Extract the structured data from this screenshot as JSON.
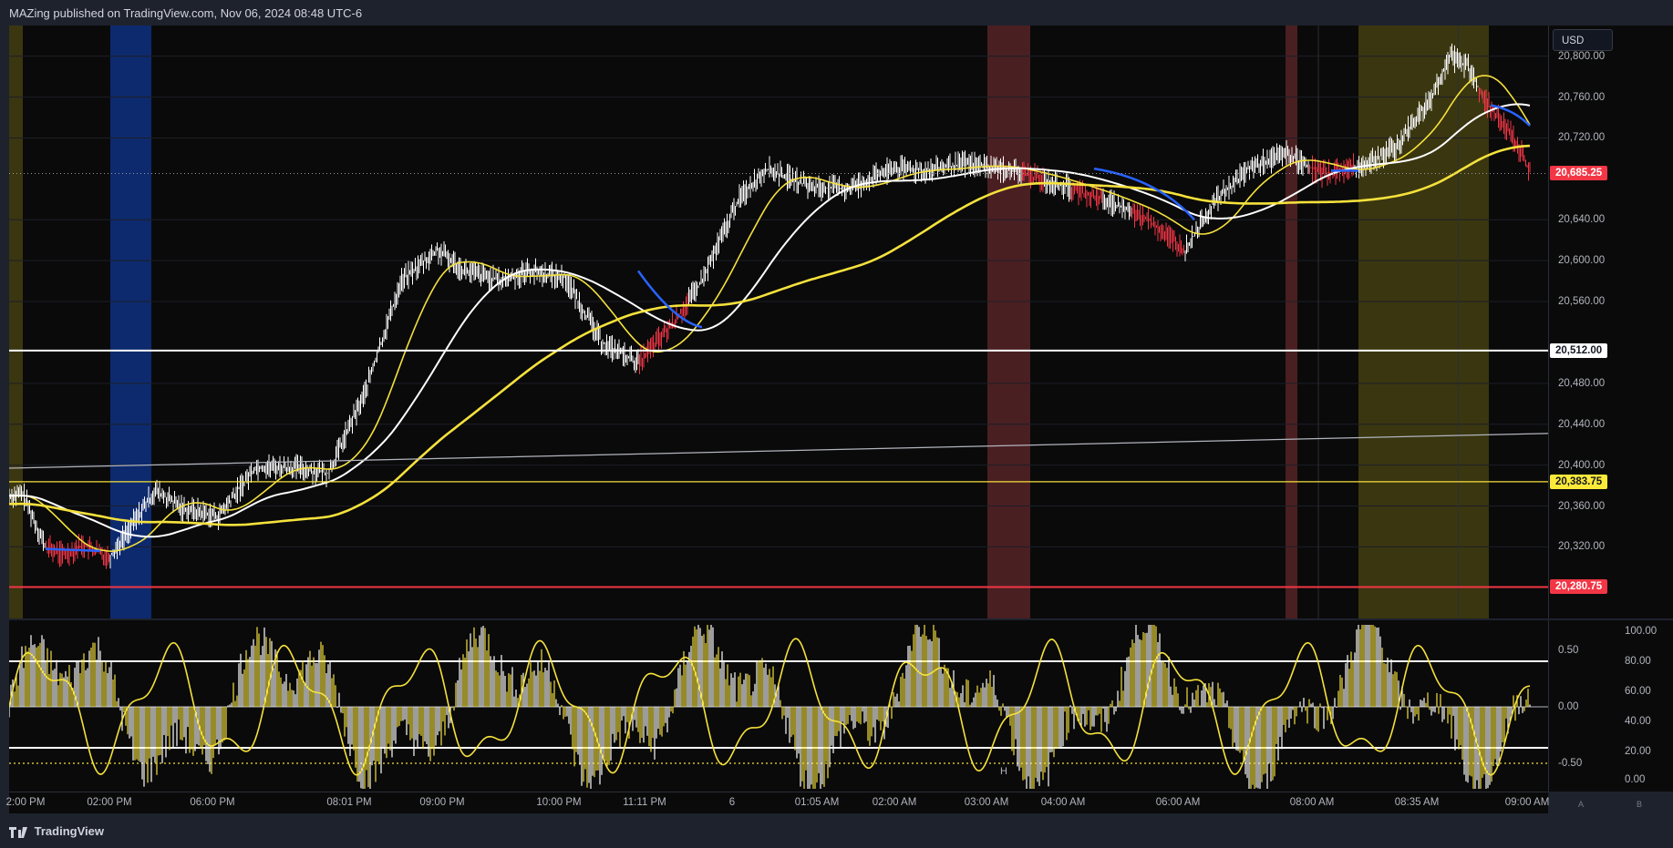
{
  "header": {
    "publish_line": "MAZing published on TradingView.com, Nov 06, 2024 08:48 UTC-6"
  },
  "price_axis": {
    "currency": "USD",
    "ticks": [
      "20,800.00",
      "20,760.00",
      "20,720.00",
      "20,640.00",
      "20,600.00",
      "20,560.00",
      "20,480.00",
      "20,440.00",
      "20,400.00",
      "20,360.00",
      "20,320.00"
    ],
    "tick_values": [
      20800,
      20760,
      20720,
      20640,
      20600,
      20560,
      20480,
      20440,
      20400,
      20360,
      20320
    ],
    "labels": {
      "last_price": "20,685.25",
      "level_white": "20,512.00",
      "level_yellow": "20,383.75",
      "level_red": "20,280.75"
    },
    "label_values": {
      "last_price": 20685.25,
      "level_white": 20512,
      "level_yellow": 20383.75,
      "level_red": 20280.75
    },
    "range": [
      20250,
      20830
    ]
  },
  "oscillator_axis": {
    "left_ticks": [
      "0.50",
      "0.00",
      "-0.50"
    ],
    "right_ticks": [
      "100.00",
      "80.00",
      "60.00",
      "40.00",
      "20.00",
      "0.00"
    ]
  },
  "time_axis": {
    "ticks": [
      "2:00 PM",
      "02:00 PM",
      "06:00 PM",
      "08:01 PM",
      "09:00 PM",
      "10:00 PM",
      "11:11 PM",
      "6",
      "01:05 AM",
      "02:00 AM",
      "03:00 AM",
      "04:00 AM",
      "06:00 AM",
      "08:00 AM",
      "08:35 AM",
      "09:00 AM"
    ],
    "corner_buttons": [
      "A",
      "B"
    ]
  },
  "oscillator_marker": "H",
  "footer": {
    "brand": "TradingView"
  },
  "colors": {
    "background": "#0a0a0a",
    "panel": "#1e222d",
    "price_white": "#ffffff",
    "price_red": "#f23645",
    "ma_yellow": "#f5e13c",
    "ma_blue": "#2962ff",
    "session_yellow": "#3a3610",
    "session_blue": "#0d2a6e",
    "session_red": "#4a1f22",
    "last_price_label": "#f23645",
    "yellow_label": "#fbe93a"
  }
}
